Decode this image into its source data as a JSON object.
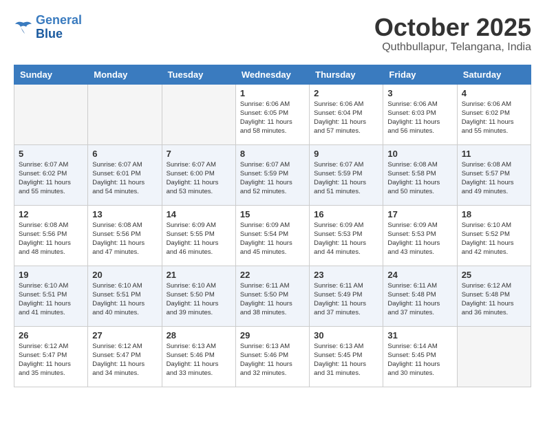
{
  "header": {
    "logo": {
      "line1": "General",
      "line2": "Blue"
    },
    "month": "October 2025",
    "location": "Quthbullapur, Telangana, India"
  },
  "weekdays": [
    "Sunday",
    "Monday",
    "Tuesday",
    "Wednesday",
    "Thursday",
    "Friday",
    "Saturday"
  ],
  "weeks": [
    [
      {
        "day": "",
        "empty": true
      },
      {
        "day": "",
        "empty": true
      },
      {
        "day": "",
        "empty": true
      },
      {
        "day": "1",
        "info": "Sunrise: 6:06 AM\nSunset: 6:05 PM\nDaylight: 11 hours\nand 58 minutes."
      },
      {
        "day": "2",
        "info": "Sunrise: 6:06 AM\nSunset: 6:04 PM\nDaylight: 11 hours\nand 57 minutes."
      },
      {
        "day": "3",
        "info": "Sunrise: 6:06 AM\nSunset: 6:03 PM\nDaylight: 11 hours\nand 56 minutes."
      },
      {
        "day": "4",
        "info": "Sunrise: 6:06 AM\nSunset: 6:02 PM\nDaylight: 11 hours\nand 55 minutes."
      }
    ],
    [
      {
        "day": "5",
        "info": "Sunrise: 6:07 AM\nSunset: 6:02 PM\nDaylight: 11 hours\nand 55 minutes."
      },
      {
        "day": "6",
        "info": "Sunrise: 6:07 AM\nSunset: 6:01 PM\nDaylight: 11 hours\nand 54 minutes."
      },
      {
        "day": "7",
        "info": "Sunrise: 6:07 AM\nSunset: 6:00 PM\nDaylight: 11 hours\nand 53 minutes."
      },
      {
        "day": "8",
        "info": "Sunrise: 6:07 AM\nSunset: 5:59 PM\nDaylight: 11 hours\nand 52 minutes."
      },
      {
        "day": "9",
        "info": "Sunrise: 6:07 AM\nSunset: 5:59 PM\nDaylight: 11 hours\nand 51 minutes."
      },
      {
        "day": "10",
        "info": "Sunrise: 6:08 AM\nSunset: 5:58 PM\nDaylight: 11 hours\nand 50 minutes."
      },
      {
        "day": "11",
        "info": "Sunrise: 6:08 AM\nSunset: 5:57 PM\nDaylight: 11 hours\nand 49 minutes."
      }
    ],
    [
      {
        "day": "12",
        "info": "Sunrise: 6:08 AM\nSunset: 5:56 PM\nDaylight: 11 hours\nand 48 minutes."
      },
      {
        "day": "13",
        "info": "Sunrise: 6:08 AM\nSunset: 5:56 PM\nDaylight: 11 hours\nand 47 minutes."
      },
      {
        "day": "14",
        "info": "Sunrise: 6:09 AM\nSunset: 5:55 PM\nDaylight: 11 hours\nand 46 minutes."
      },
      {
        "day": "15",
        "info": "Sunrise: 6:09 AM\nSunset: 5:54 PM\nDaylight: 11 hours\nand 45 minutes."
      },
      {
        "day": "16",
        "info": "Sunrise: 6:09 AM\nSunset: 5:53 PM\nDaylight: 11 hours\nand 44 minutes."
      },
      {
        "day": "17",
        "info": "Sunrise: 6:09 AM\nSunset: 5:53 PM\nDaylight: 11 hours\nand 43 minutes."
      },
      {
        "day": "18",
        "info": "Sunrise: 6:10 AM\nSunset: 5:52 PM\nDaylight: 11 hours\nand 42 minutes."
      }
    ],
    [
      {
        "day": "19",
        "info": "Sunrise: 6:10 AM\nSunset: 5:51 PM\nDaylight: 11 hours\nand 41 minutes."
      },
      {
        "day": "20",
        "info": "Sunrise: 6:10 AM\nSunset: 5:51 PM\nDaylight: 11 hours\nand 40 minutes."
      },
      {
        "day": "21",
        "info": "Sunrise: 6:10 AM\nSunset: 5:50 PM\nDaylight: 11 hours\nand 39 minutes."
      },
      {
        "day": "22",
        "info": "Sunrise: 6:11 AM\nSunset: 5:50 PM\nDaylight: 11 hours\nand 38 minutes."
      },
      {
        "day": "23",
        "info": "Sunrise: 6:11 AM\nSunset: 5:49 PM\nDaylight: 11 hours\nand 37 minutes."
      },
      {
        "day": "24",
        "info": "Sunrise: 6:11 AM\nSunset: 5:48 PM\nDaylight: 11 hours\nand 37 minutes."
      },
      {
        "day": "25",
        "info": "Sunrise: 6:12 AM\nSunset: 5:48 PM\nDaylight: 11 hours\nand 36 minutes."
      }
    ],
    [
      {
        "day": "26",
        "info": "Sunrise: 6:12 AM\nSunset: 5:47 PM\nDaylight: 11 hours\nand 35 minutes."
      },
      {
        "day": "27",
        "info": "Sunrise: 6:12 AM\nSunset: 5:47 PM\nDaylight: 11 hours\nand 34 minutes."
      },
      {
        "day": "28",
        "info": "Sunrise: 6:13 AM\nSunset: 5:46 PM\nDaylight: 11 hours\nand 33 minutes."
      },
      {
        "day": "29",
        "info": "Sunrise: 6:13 AM\nSunset: 5:46 PM\nDaylight: 11 hours\nand 32 minutes."
      },
      {
        "day": "30",
        "info": "Sunrise: 6:13 AM\nSunset: 5:45 PM\nDaylight: 11 hours\nand 31 minutes."
      },
      {
        "day": "31",
        "info": "Sunrise: 6:14 AM\nSunset: 5:45 PM\nDaylight: 11 hours\nand 30 minutes."
      },
      {
        "day": "",
        "empty": true
      }
    ]
  ]
}
